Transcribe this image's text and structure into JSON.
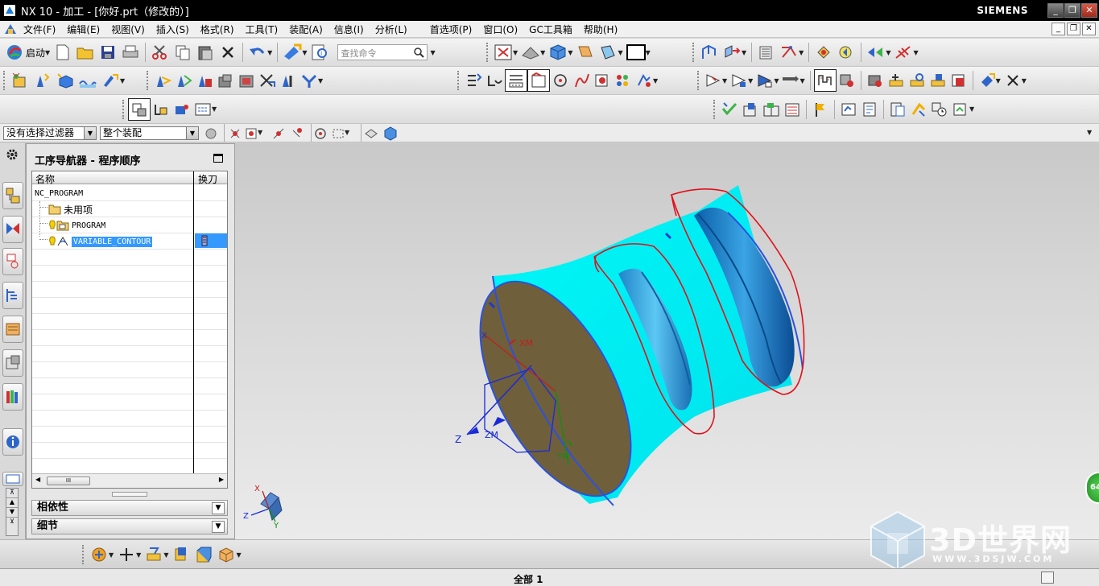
{
  "window": {
    "title": "NX 10 - 加工 - [你好.prt（修改的）]",
    "brand": "SIEMENS",
    "controls": [
      "_",
      "❐",
      "✕"
    ]
  },
  "menubar": {
    "items": [
      "文件(F)",
      "编辑(E)",
      "视图(V)",
      "插入(S)",
      "格式(R)",
      "工具(T)",
      "装配(A)",
      "信息(I)",
      "分析(L)",
      "首选项(P)",
      "窗口(O)",
      "GC工具箱",
      "帮助(H)"
    ]
  },
  "toolbar": {
    "start_label": "启动",
    "search_placeholder": "查找命令"
  },
  "filterbar": {
    "selection_filter": "没有选择过滤器",
    "assembly_scope": "整个装配"
  },
  "navigator": {
    "title": "工序导航器 - 程序顺序",
    "columns": [
      "名称",
      "换刀"
    ],
    "rows": [
      {
        "label": "NC_PROGRAM",
        "level": 0
      },
      {
        "label": "未用项",
        "level": 1
      },
      {
        "label": "PROGRAM",
        "level": 1
      },
      {
        "label": "VARIABLE_CONTOUR",
        "level": 1,
        "selected": true
      }
    ],
    "scroll_thumb": "III",
    "panels": [
      "相依性",
      "细节"
    ]
  },
  "viewport": {
    "csys_labels": {
      "xm": "XM",
      "ym": "YM",
      "zm": "ZM",
      "z": "Z"
    },
    "triad_labels": {
      "x": "X",
      "y": "Y",
      "z": "Z"
    },
    "part_color": "#00f0f0",
    "face_color": "#6e5f3a",
    "markup_color": "#e0101a"
  },
  "statusbar": {
    "text": "全部  1"
  },
  "watermark": {
    "text": "3D世界网",
    "url": "WWW.3DSJW.COM"
  },
  "perf_badge": "64"
}
